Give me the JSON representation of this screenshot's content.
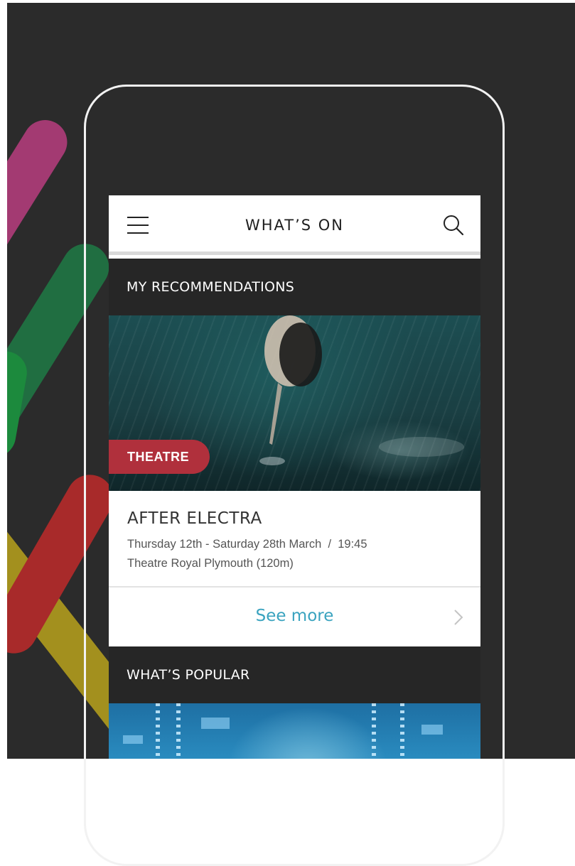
{
  "topbar": {
    "title": "WHAT’S ON",
    "menu_icon": "hamburger-icon",
    "search_icon": "search-icon"
  },
  "recommendations": {
    "title": "MY RECOMMENDATIONS",
    "card": {
      "category": "THEATRE",
      "title": "AFTER ELECTRA",
      "dates": "Thursday 12th - Saturday 28th March  /  19:45",
      "venue": "Theatre Royal Plymouth (120m)"
    },
    "see_more": "See more",
    "chevron_icon": "chevron-right-icon"
  },
  "popular": {
    "title": "WHAT’S POPULAR"
  },
  "colors": {
    "background": "#2b2b2b",
    "section_header": "#262626",
    "badge": "#b0303c",
    "link": "#3aa3bf",
    "stripe_magenta": "#a33a72",
    "stripe_green": "#1e7a45",
    "stripe_red": "#a82a2a",
    "stripe_yellow": "#b8a21c"
  }
}
